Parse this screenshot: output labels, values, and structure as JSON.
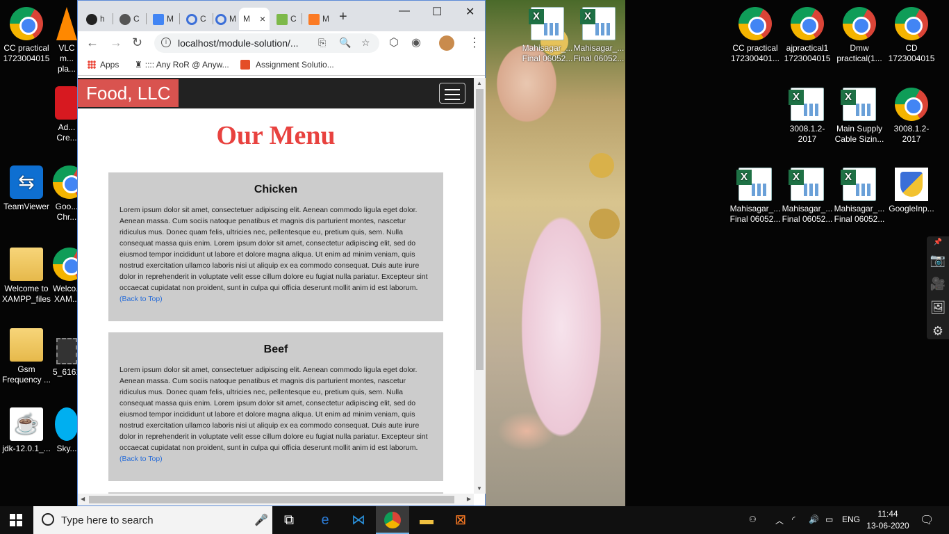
{
  "desktop": {
    "left_icons": [
      {
        "label": "CC practical 1723004015",
        "type": "chrome"
      },
      {
        "label": "VLC m... pla...",
        "type": "vlc"
      },
      {
        "label": "Ad... Cre...",
        "type": "adobe"
      },
      {
        "label": "TeamViewer",
        "type": "teamviewer"
      },
      {
        "label": "Goo... Chr...",
        "type": "chrome"
      },
      {
        "label": "Welcome to XAMPP_files",
        "type": "folder"
      },
      {
        "label": "Welco... XAM...",
        "type": "chrome"
      },
      {
        "label": "Gsm Frequency ...",
        "type": "folder"
      },
      {
        "label": "5_6161...",
        "type": "video"
      },
      {
        "label": "jdk-12.0.1_...",
        "type": "java"
      },
      {
        "label": "Sky...",
        "type": "skype"
      }
    ],
    "mid_icons": [
      {
        "label": "Mahisagar_... Final 06052...",
        "type": "excel"
      },
      {
        "label": "Mahisagar_... Final 06052...",
        "type": "excel"
      }
    ],
    "right_icons": [
      {
        "label": "CC practical 172300401...",
        "type": "chrome"
      },
      {
        "label": "ajpractical1 1723004015",
        "type": "chrome"
      },
      {
        "label": "Dmw practical(1...",
        "type": "chrome"
      },
      {
        "label": "CD 1723004015",
        "type": "chrome"
      },
      {
        "label": "3008.1.2-2017",
        "type": "excel"
      },
      {
        "label": "Main Supply Cable Sizin...",
        "type": "excel"
      },
      {
        "label": "3008.1.2-2017",
        "type": "chrome"
      },
      {
        "label": "Mahisagar_... Final 06052...",
        "type": "excel"
      },
      {
        "label": "Mahisagar_... Final 06052...",
        "type": "excel"
      },
      {
        "label": "Mahisagar_... Final 06052...",
        "type": "excel"
      },
      {
        "label": "GoogleInp...",
        "type": "shield"
      }
    ],
    "side_toolbar": [
      "pin-icon",
      "camera-icon",
      "video-icon",
      "gallery-icon",
      "settings-icon"
    ]
  },
  "browser": {
    "tabs": [
      {
        "label": "h",
        "icon": "github-icon"
      },
      {
        "label": "C",
        "icon": "globe-icon"
      },
      {
        "label": "M",
        "icon": "docs-icon"
      },
      {
        "label": "C",
        "icon": "link-icon"
      },
      {
        "label": "M",
        "icon": "link-icon"
      },
      {
        "label": "M",
        "icon": "active-tab",
        "close": "×"
      },
      {
        "label": "C",
        "icon": "w3-icon"
      },
      {
        "label": "M",
        "icon": "xampp-icon"
      }
    ],
    "new_tab": "+",
    "window_controls": {
      "minimize": "—",
      "maximize": "☐",
      "close": "✕"
    },
    "url": "localhost/module-solution/...",
    "bookmarks": [
      {
        "label": "Apps"
      },
      {
        "label": ":::: Any RoR @ Anyw..."
      },
      {
        "label": "Assignment Solutio..."
      }
    ]
  },
  "page": {
    "brand": "Food, LLC",
    "title": "Our Menu",
    "sections": [
      {
        "heading": "Chicken",
        "body": "Lorem ipsum dolor sit amet, consectetuer adipiscing elit. Aenean commodo ligula eget dolor. Aenean massa. Cum sociis natoque penatibus et magnis dis parturient montes, nascetur ridiculus mus. Donec quam felis, ultricies nec, pellentesque eu, pretium quis, sem. Nulla consequat massa quis enim. Lorem ipsum dolor sit amet, consectetur adipiscing elit, sed do eiusmod tempor incididunt ut labore et dolore magna aliqua. Ut enim ad minim veniam, quis nostrud exercitation ullamco laboris nisi ut aliquip ex ea commodo consequat. Duis aute irure dolor in reprehenderit in voluptate velit esse cillum dolore eu fugiat nulla pariatur. Excepteur sint occaecat cupidatat non proident, sunt in culpa qui officia deserunt mollit anim id est laborum.",
        "link": "(Back to Top)"
      },
      {
        "heading": "Beef",
        "body": "Lorem ipsum dolor sit amet, consectetuer adipiscing elit. Aenean commodo ligula eget dolor. Aenean massa. Cum sociis natoque penatibus et magnis dis parturient montes, nascetur ridiculus mus. Donec quam felis, ultricies nec, pellentesque eu, pretium quis, sem. Nulla consequat massa quis enim. Lorem ipsum dolor sit amet, consectetur adipiscing elit, sed do eiusmod tempor incididunt ut labore et dolore magna aliqua. Ut enim ad minim veniam, quis nostrud exercitation ullamco laboris nisi ut aliquip ex ea commodo consequat. Duis aute irure dolor in reprehenderit in voluptate velit esse cillum dolore eu fugiat nulla pariatur. Excepteur sint occaecat cupidatat non proident, sunt in culpa qui officia deserunt mollit anim id est laborum.",
        "link": "(Back to Top)"
      }
    ],
    "colors": {
      "brand_bg": "#d9534f",
      "navbar": "#222222",
      "title": "#e8423f",
      "section_bg": "#cccccc",
      "link": "#2a6ed8"
    }
  },
  "taskbar": {
    "search_placeholder": "Type here to search",
    "apps": [
      "task-view-icon",
      "edge-icon",
      "vscode-icon",
      "chrome-icon",
      "explorer-icon",
      "xampp-icon"
    ],
    "language": "ENG",
    "time": "11:44",
    "date": "13-06-2020"
  }
}
